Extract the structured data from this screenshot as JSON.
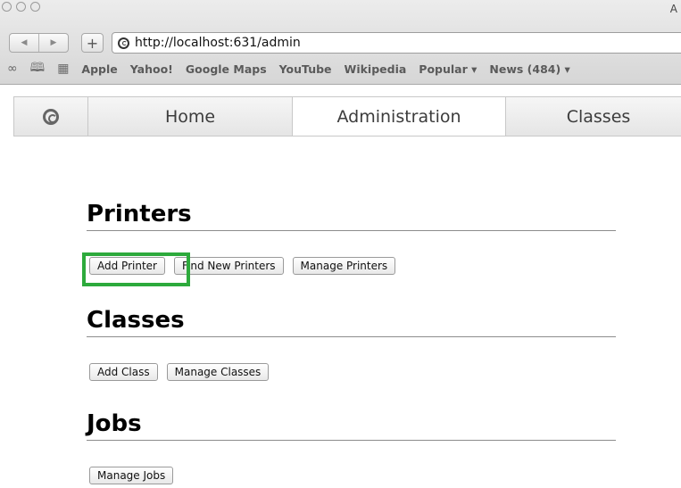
{
  "window": {
    "title_fragment": "A"
  },
  "nav": {
    "back": "◀",
    "forward": "▶",
    "new_tab": "+"
  },
  "url": "http://localhost:631/admin",
  "bookmarks": [
    "Apple",
    "Yahoo!",
    "Google Maps",
    "YouTube",
    "Wikipedia",
    "Popular ▾",
    "News (484) ▾"
  ],
  "tabs": {
    "home": "Home",
    "admin": "Administration",
    "classes": "Classes"
  },
  "sections": {
    "printers": {
      "title": "Printers",
      "add": "Add Printer",
      "find": "Find New Printers",
      "manage": "Manage Printers"
    },
    "classes": {
      "title": "Classes",
      "add": "Add Class",
      "manage": "Manage Classes"
    },
    "jobs": {
      "title": "Jobs",
      "manage": "Manage Jobs"
    }
  },
  "colors": {
    "highlight": "#2daa3c"
  }
}
